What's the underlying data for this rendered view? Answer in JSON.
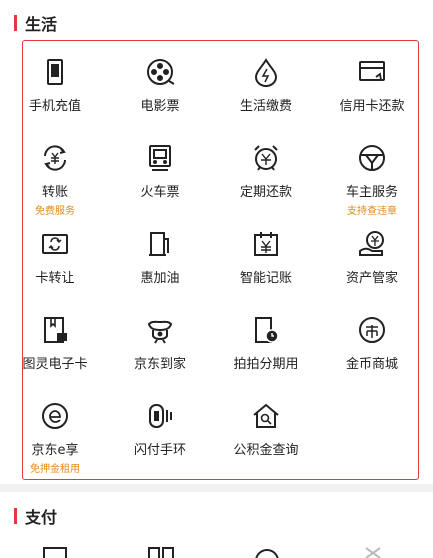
{
  "sections": {
    "life": {
      "title": "生活"
    },
    "pay": {
      "title": "支付"
    }
  },
  "accent_color": "#e4393c",
  "sub_label_color": "#e08a1e",
  "items": [
    {
      "label": "手机充值",
      "icon": "phone-icon"
    },
    {
      "label": "电影票",
      "icon": "film-reel-icon"
    },
    {
      "label": "生活缴费",
      "icon": "water-drop-icon"
    },
    {
      "label": "信用卡还款",
      "icon": "credit-card-icon"
    },
    {
      "label": "转账",
      "sub": "免费服务",
      "icon": "transfer-icon"
    },
    {
      "label": "火车票",
      "icon": "train-icon"
    },
    {
      "label": "定期还款",
      "icon": "alarm-clock-icon"
    },
    {
      "label": "车主服务",
      "sub": "支持查违章",
      "icon": "steering-wheel-icon"
    },
    {
      "label": "卡转让",
      "icon": "card-transfer-icon"
    },
    {
      "label": "惠加油",
      "icon": "fuel-pump-icon"
    },
    {
      "label": "智能记账",
      "icon": "calendar-yuan-icon"
    },
    {
      "label": "资产管家",
      "icon": "hand-coin-icon"
    },
    {
      "label": "图灵电子卡",
      "icon": "gift-card-icon"
    },
    {
      "label": "京东到家",
      "icon": "mascot-icon"
    },
    {
      "label": "拍拍分期用",
      "icon": "installment-icon"
    },
    {
      "label": "金币商城",
      "icon": "coin-icon"
    },
    {
      "label": "京东e享",
      "sub": "免押金租用",
      "icon": "e-circle-icon"
    },
    {
      "label": "闪付手环",
      "icon": "wristband-icon"
    },
    {
      "label": "公积金查询",
      "icon": "house-search-icon"
    }
  ]
}
